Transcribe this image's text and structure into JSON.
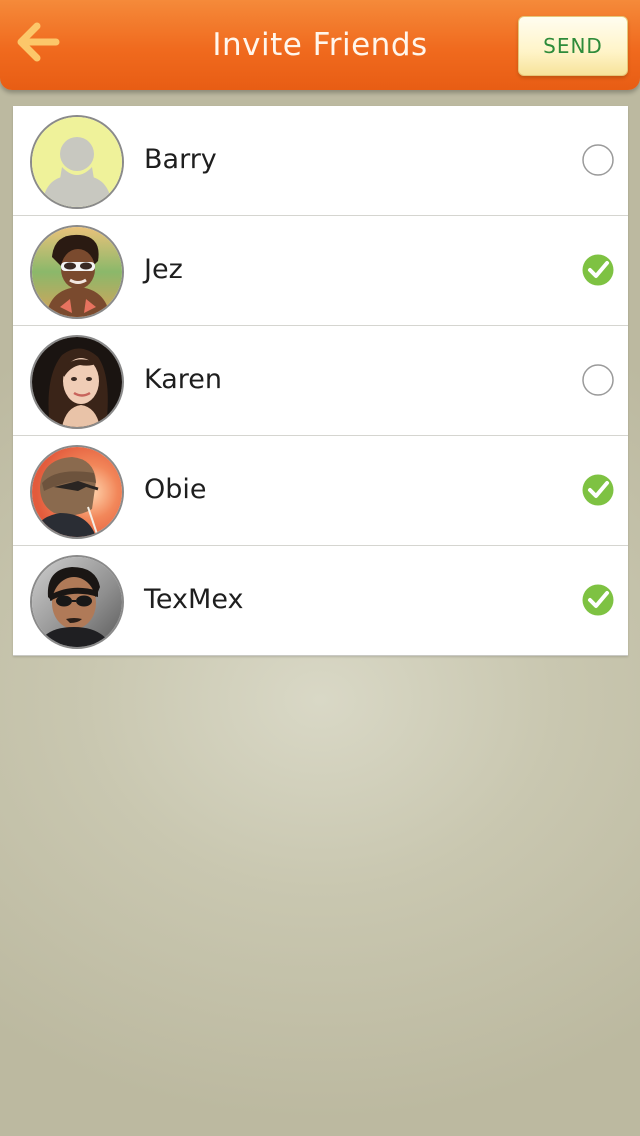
{
  "header": {
    "title": "Invite Friends",
    "send_label": "SEND",
    "back_icon": "arrow-left-icon"
  },
  "colors": {
    "header_orange": "#f06a1e",
    "send_text_green": "#2e8b3a",
    "check_green": "#7ec242"
  },
  "friends": [
    {
      "name": "Barry",
      "selected": false
    },
    {
      "name": "Jez",
      "selected": true
    },
    {
      "name": "Karen",
      "selected": false
    },
    {
      "name": "Obie",
      "selected": true
    },
    {
      "name": "TexMex",
      "selected": true
    }
  ]
}
